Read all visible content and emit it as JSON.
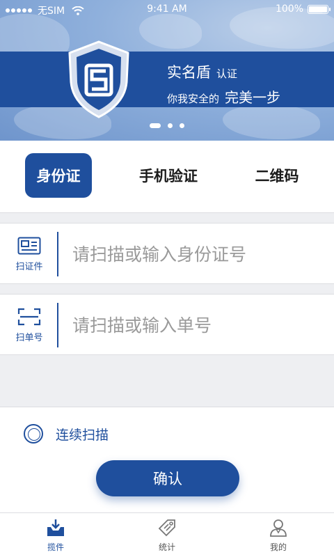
{
  "status_bar": {
    "carrier": "无SIM",
    "time": "9:41 AM",
    "battery": "100%",
    "battery_level": 1.0
  },
  "banner": {
    "brand": "实名盾",
    "brand_sub": "认证",
    "slogan_a": "你我安全的",
    "slogan_b": "完美一步",
    "slide_count": 3,
    "active_slide": 1
  },
  "tabs": [
    {
      "label": "身份证",
      "active": true
    },
    {
      "label": "手机验证",
      "active": false
    },
    {
      "label": "二维码",
      "active": false
    }
  ],
  "id_row": {
    "caption": "扫证件",
    "placeholder": "请扫描或输入身份证号",
    "value": "",
    "icon": "id-card-icon"
  },
  "order_row": {
    "caption": "扫单号",
    "placeholder": "请扫描或输入单号",
    "value": "",
    "icon": "scan-frame-icon"
  },
  "continuous_scan": {
    "label": "连续扫描",
    "checked": false
  },
  "confirm_label": "确认",
  "tabbar": [
    {
      "label": "揽件",
      "icon": "inbox-download-icon",
      "active": true
    },
    {
      "label": "统计",
      "icon": "price-tag-icon",
      "active": false
    },
    {
      "label": "我的",
      "icon": "user-icon",
      "active": false
    }
  ],
  "colors": {
    "primary": "#1f4f9d",
    "background": "#eeeff2",
    "placeholder": "#9a9a9a"
  }
}
